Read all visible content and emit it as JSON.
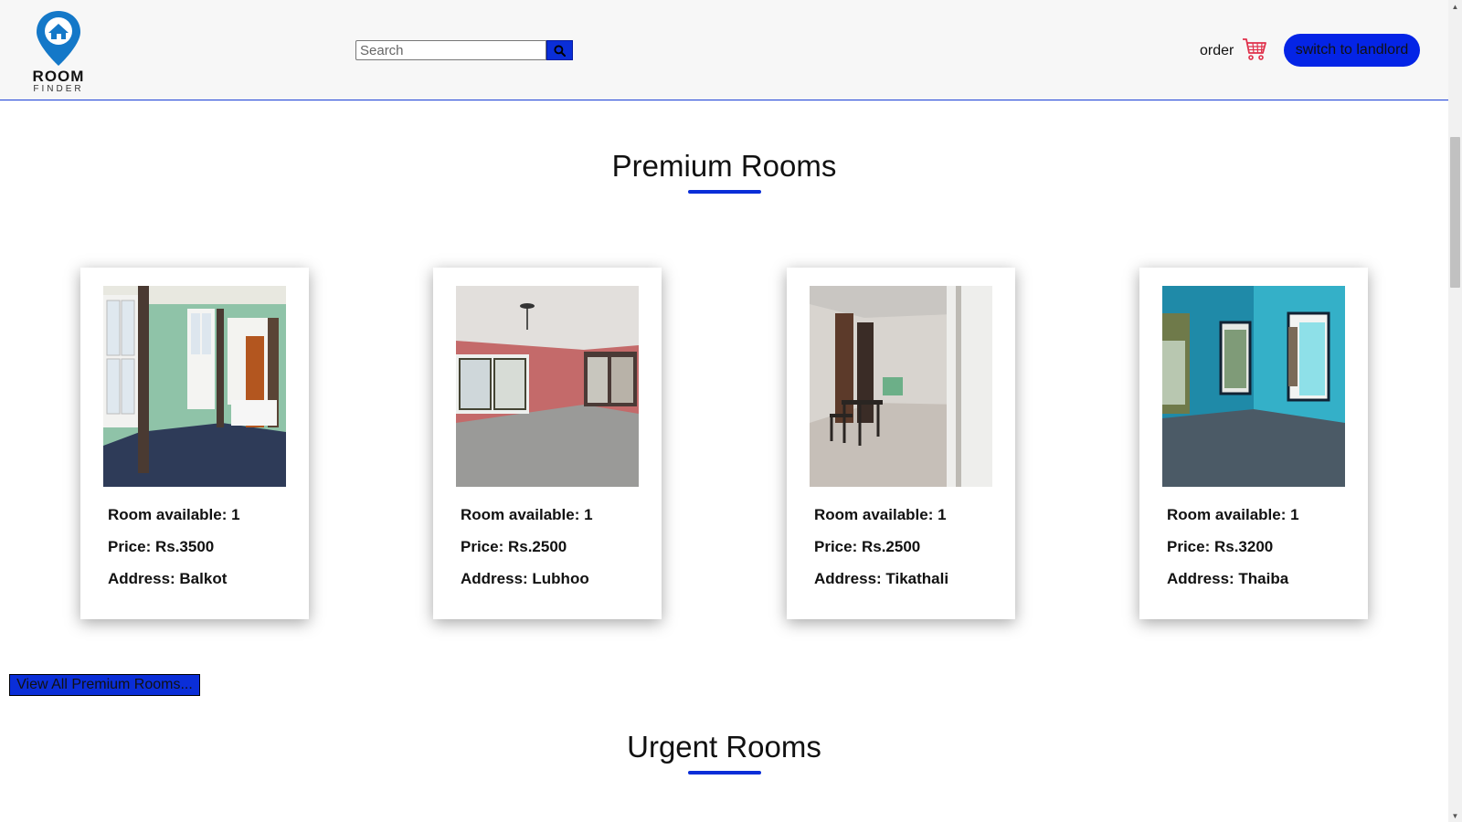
{
  "header": {
    "logo_word1": "ROOM",
    "logo_word2": "FINDER",
    "search_placeholder": "Search",
    "search_icon": "search-icon",
    "order_label": "order",
    "cart_icon": "cart-icon",
    "switch_label": "switch to landlord"
  },
  "premium": {
    "title": "Premium Rooms",
    "cards": [
      {
        "available": "Room available: 1",
        "price": "Price: Rs.3500",
        "address": "Address: Balkot"
      },
      {
        "available": "Room available: 1",
        "price": "Price: Rs.2500",
        "address": "Address: Lubhoo"
      },
      {
        "available": "Room available: 1",
        "price": "Price: Rs.2500",
        "address": "Address: Tikathali"
      },
      {
        "available": "Room available: 1",
        "price": "Price: Rs.3200",
        "address": "Address: Thaiba"
      }
    ],
    "view_all_label": "View All Premium Rooms..."
  },
  "urgent": {
    "title": "Urgent Rooms"
  },
  "colors": {
    "accent_blue": "#0a2ed8",
    "button_blue": "#0424e6",
    "cart_red": "#e0314b",
    "logo_blue": "#1478c8"
  }
}
